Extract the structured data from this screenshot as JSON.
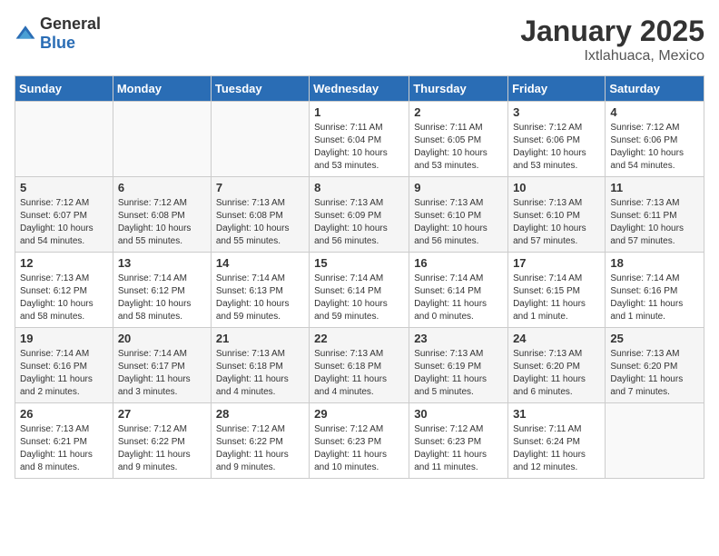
{
  "logo": {
    "general": "General",
    "blue": "Blue"
  },
  "header": {
    "month": "January 2025",
    "location": "Ixtlahuaca, Mexico"
  },
  "weekdays": [
    "Sunday",
    "Monday",
    "Tuesday",
    "Wednesday",
    "Thursday",
    "Friday",
    "Saturday"
  ],
  "weeks": [
    [
      {
        "day": "",
        "info": ""
      },
      {
        "day": "",
        "info": ""
      },
      {
        "day": "",
        "info": ""
      },
      {
        "day": "1",
        "info": "Sunrise: 7:11 AM\nSunset: 6:04 PM\nDaylight: 10 hours\nand 53 minutes."
      },
      {
        "day": "2",
        "info": "Sunrise: 7:11 AM\nSunset: 6:05 PM\nDaylight: 10 hours\nand 53 minutes."
      },
      {
        "day": "3",
        "info": "Sunrise: 7:12 AM\nSunset: 6:06 PM\nDaylight: 10 hours\nand 53 minutes."
      },
      {
        "day": "4",
        "info": "Sunrise: 7:12 AM\nSunset: 6:06 PM\nDaylight: 10 hours\nand 54 minutes."
      }
    ],
    [
      {
        "day": "5",
        "info": "Sunrise: 7:12 AM\nSunset: 6:07 PM\nDaylight: 10 hours\nand 54 minutes."
      },
      {
        "day": "6",
        "info": "Sunrise: 7:12 AM\nSunset: 6:08 PM\nDaylight: 10 hours\nand 55 minutes."
      },
      {
        "day": "7",
        "info": "Sunrise: 7:13 AM\nSunset: 6:08 PM\nDaylight: 10 hours\nand 55 minutes."
      },
      {
        "day": "8",
        "info": "Sunrise: 7:13 AM\nSunset: 6:09 PM\nDaylight: 10 hours\nand 56 minutes."
      },
      {
        "day": "9",
        "info": "Sunrise: 7:13 AM\nSunset: 6:10 PM\nDaylight: 10 hours\nand 56 minutes."
      },
      {
        "day": "10",
        "info": "Sunrise: 7:13 AM\nSunset: 6:10 PM\nDaylight: 10 hours\nand 57 minutes."
      },
      {
        "day": "11",
        "info": "Sunrise: 7:13 AM\nSunset: 6:11 PM\nDaylight: 10 hours\nand 57 minutes."
      }
    ],
    [
      {
        "day": "12",
        "info": "Sunrise: 7:13 AM\nSunset: 6:12 PM\nDaylight: 10 hours\nand 58 minutes."
      },
      {
        "day": "13",
        "info": "Sunrise: 7:14 AM\nSunset: 6:12 PM\nDaylight: 10 hours\nand 58 minutes."
      },
      {
        "day": "14",
        "info": "Sunrise: 7:14 AM\nSunset: 6:13 PM\nDaylight: 10 hours\nand 59 minutes."
      },
      {
        "day": "15",
        "info": "Sunrise: 7:14 AM\nSunset: 6:14 PM\nDaylight: 10 hours\nand 59 minutes."
      },
      {
        "day": "16",
        "info": "Sunrise: 7:14 AM\nSunset: 6:14 PM\nDaylight: 11 hours\nand 0 minutes."
      },
      {
        "day": "17",
        "info": "Sunrise: 7:14 AM\nSunset: 6:15 PM\nDaylight: 11 hours\nand 1 minute."
      },
      {
        "day": "18",
        "info": "Sunrise: 7:14 AM\nSunset: 6:16 PM\nDaylight: 11 hours\nand 1 minute."
      }
    ],
    [
      {
        "day": "19",
        "info": "Sunrise: 7:14 AM\nSunset: 6:16 PM\nDaylight: 11 hours\nand 2 minutes."
      },
      {
        "day": "20",
        "info": "Sunrise: 7:14 AM\nSunset: 6:17 PM\nDaylight: 11 hours\nand 3 minutes."
      },
      {
        "day": "21",
        "info": "Sunrise: 7:13 AM\nSunset: 6:18 PM\nDaylight: 11 hours\nand 4 minutes."
      },
      {
        "day": "22",
        "info": "Sunrise: 7:13 AM\nSunset: 6:18 PM\nDaylight: 11 hours\nand 4 minutes."
      },
      {
        "day": "23",
        "info": "Sunrise: 7:13 AM\nSunset: 6:19 PM\nDaylight: 11 hours\nand 5 minutes."
      },
      {
        "day": "24",
        "info": "Sunrise: 7:13 AM\nSunset: 6:20 PM\nDaylight: 11 hours\nand 6 minutes."
      },
      {
        "day": "25",
        "info": "Sunrise: 7:13 AM\nSunset: 6:20 PM\nDaylight: 11 hours\nand 7 minutes."
      }
    ],
    [
      {
        "day": "26",
        "info": "Sunrise: 7:13 AM\nSunset: 6:21 PM\nDaylight: 11 hours\nand 8 minutes."
      },
      {
        "day": "27",
        "info": "Sunrise: 7:12 AM\nSunset: 6:22 PM\nDaylight: 11 hours\nand 9 minutes."
      },
      {
        "day": "28",
        "info": "Sunrise: 7:12 AM\nSunset: 6:22 PM\nDaylight: 11 hours\nand 9 minutes."
      },
      {
        "day": "29",
        "info": "Sunrise: 7:12 AM\nSunset: 6:23 PM\nDaylight: 11 hours\nand 10 minutes."
      },
      {
        "day": "30",
        "info": "Sunrise: 7:12 AM\nSunset: 6:23 PM\nDaylight: 11 hours\nand 11 minutes."
      },
      {
        "day": "31",
        "info": "Sunrise: 7:11 AM\nSunset: 6:24 PM\nDaylight: 11 hours\nand 12 minutes."
      },
      {
        "day": "",
        "info": ""
      }
    ]
  ]
}
